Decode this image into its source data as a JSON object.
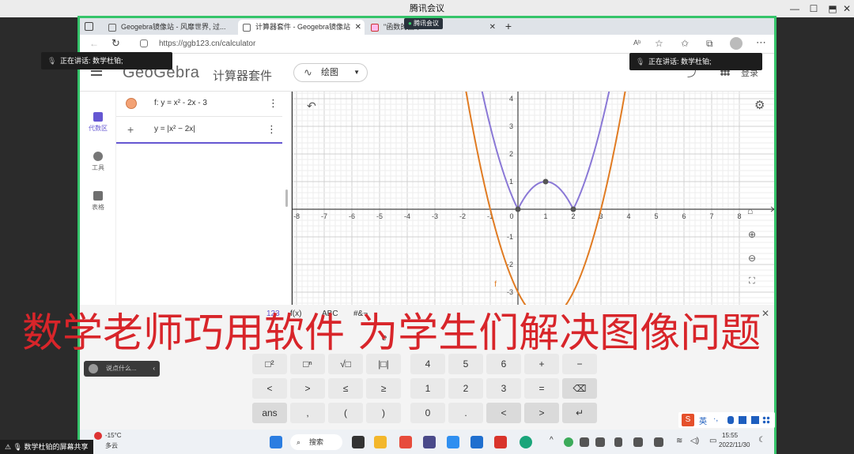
{
  "meeting": {
    "title": "腾讯会议",
    "badge": "腾讯会议",
    "share_label": "数学杜铂的屏幕共享"
  },
  "speaking": [
    {
      "label": "正在讲话: 数学杜铂;"
    },
    {
      "label": "正在讲话: 数学杜铂;"
    }
  ],
  "browser": {
    "tabs": [
      {
        "label": "Geogebra镜像站 - 风靡世界, 过..."
      },
      {
        "label": "计算器套件 - Geogebra镜像站"
      },
      {
        "label": "\"函数的图象\"..."
      }
    ],
    "url": "https://ggb123.cn/calculator",
    "new_tab": "+"
  },
  "app": {
    "logo": "GeoGebra",
    "suite": "计算器套件",
    "mode": "绘图",
    "login": "登录"
  },
  "sidebar": [
    {
      "label": "代数区",
      "icon": "calculator-icon"
    },
    {
      "label": "工具",
      "icon": "tools-icon"
    },
    {
      "label": "表格",
      "icon": "table-icon"
    }
  ],
  "algebra": {
    "row1": "f: y = x² - 2x - 3",
    "row2": "y = |x² − 2x|",
    "plus": "+",
    "menu": "⋮"
  },
  "graph": {
    "x_ticks": [
      "-8",
      "-7",
      "-6",
      "-5",
      "-4",
      "-3",
      "-2",
      "-1",
      "0",
      "1",
      "2",
      "3",
      "4",
      "5",
      "6",
      "7",
      "8"
    ],
    "y_ticks": [
      "4",
      "3",
      "2",
      "1",
      "-1",
      "-2",
      "-3"
    ],
    "func_label": "f"
  },
  "chart_data": {
    "type": "line",
    "series": [
      {
        "name": "f",
        "expr": "y = x^2 - 2x - 3",
        "color": "#e07b22"
      },
      {
        "name": "",
        "expr": "y = |x^2 - 2x|",
        "color": "#8a78d6"
      }
    ],
    "points": [
      {
        "x": 0,
        "y": 0
      },
      {
        "x": 1,
        "y": 1
      },
      {
        "x": 2,
        "y": 0
      }
    ],
    "xlim": [
      -8,
      8
    ],
    "ylim": [
      -3,
      4
    ],
    "grid": true
  },
  "keyboard": {
    "tabs": [
      "123",
      "f(x)",
      "ABC",
      "#&¬"
    ],
    "e_label": "e",
    "rows": [
      [
        "□²",
        "□ⁿ",
        "√□",
        "|□|",
        "4",
        "5",
        "6",
        "+",
        "−"
      ],
      [
        "<",
        ">",
        "≤",
        "≥",
        "1",
        "2",
        "3",
        "=",
        "⌫"
      ],
      [
        "ans",
        ",",
        "(",
        ")",
        "0",
        ".",
        "<",
        ">",
        "↵"
      ]
    ]
  },
  "chat": {
    "placeholder": "说点什么..."
  },
  "caption": "数学老师巧用软件 为学生们解决图像问题",
  "taskbar": {
    "search": "搜索",
    "weather_temp": "-15°C",
    "weather_desc": "多云",
    "time": "15:55",
    "date": "2022/11/30",
    "ime": "英"
  },
  "colors": {
    "orange": "#e07b22",
    "purple": "#8a78d6",
    "caption": "#d8252a",
    "frame": "#35c46a"
  }
}
